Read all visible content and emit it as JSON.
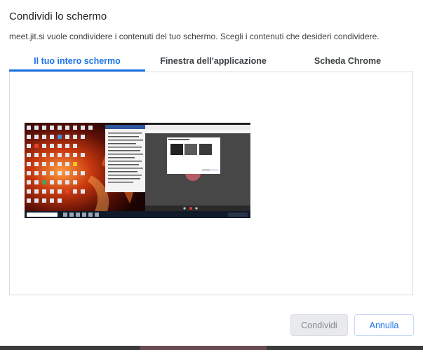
{
  "dialog": {
    "title": "Condividi lo schermo",
    "subtitle": "meet.jit.si vuole condividere i contenuti del tuo schermo. Scegli i contenuti che desideri condividere."
  },
  "tabs": [
    {
      "label": "Il tuo intero schermo",
      "active": true
    },
    {
      "label": "Finestra dell'applicazione",
      "active": false
    },
    {
      "label": "Scheda Chrome",
      "active": false
    }
  ],
  "buttons": {
    "share": "Condividi",
    "cancel": "Annulla"
  },
  "colors": {
    "accent": "#1a73e8",
    "border": "#dadce0",
    "disabled_bg": "#e8eaed"
  }
}
